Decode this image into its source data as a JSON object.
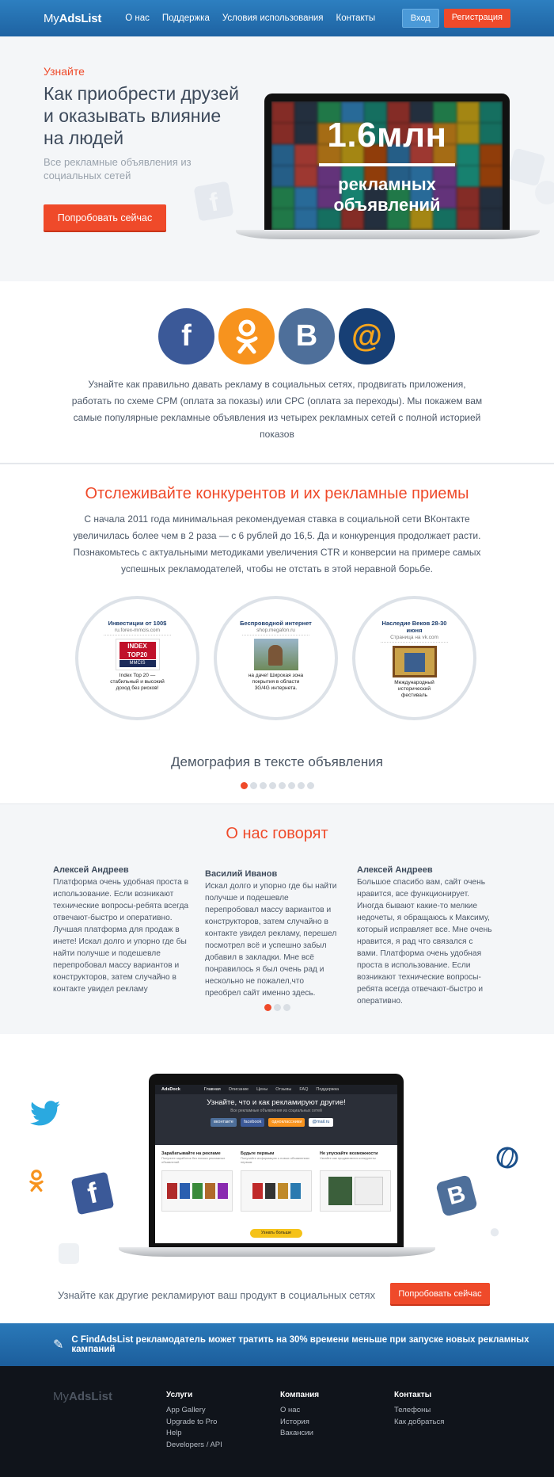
{
  "header": {
    "logo_light": "My",
    "logo_bold": "AdsList",
    "nav": [
      "О нас",
      "Поддержка",
      "Условия использования",
      "Контакты"
    ],
    "login": "Вход",
    "register": "Регистрация"
  },
  "hero": {
    "kicker": "Узнайте",
    "title": "Как приобрести друзей и оказывать влияние на людей",
    "subtitle": "Все рекламные объявления из социальных сетей",
    "cta": "Попробовать сейчас",
    "screen_number": "1.6млн",
    "screen_text_1": "рекламных",
    "screen_text_2": "объявлений"
  },
  "social": {
    "icons": [
      {
        "name": "facebook-icon",
        "glyph": "f",
        "color": "#3b5998"
      },
      {
        "name": "odnoklassniki-icon",
        "glyph": "ok",
        "color": "#f7931e"
      },
      {
        "name": "vkontakte-icon",
        "glyph": "B",
        "color": "#4e6f9a"
      },
      {
        "name": "mailru-icon",
        "glyph": "@",
        "color": "#1a4f8a"
      }
    ],
    "text": "Узнайте как правильно давать рекламу в социальных сетях, продвигать приложения, работать по схеме CPM (оплата за показы) или CPC (оплата за переходы). Мы покажем вам самые популярные рекламные объявления из четырех рекламных сетей с полной историей показов"
  },
  "competitors": {
    "title": "Отслеживайте конкурентов и их рекламные приемы",
    "text": "С начала 2011 года минимальная рекомендуемая ставка в социальной сети ВКонтакте увеличилась более чем в 2 раза — с 6 рублей до 16,5. Да и конкуренция продолжает расти. Познакомьтесь с актуальными методиками увеличения CTR и конверсии на примере самых успешных рекламодателей, чтобы не отстать в этой неравной борьбе.",
    "ads": [
      {
        "head": "Инвестиции от 100$",
        "url": "ru.forex-mmcis.com",
        "desc": "Index Top 20 — стабильный и высокий доход без рисков!",
        "img_label": "INDEX TOP20",
        "img_sub": "MMCIS"
      },
      {
        "head": "Беспроводной интернет",
        "url": "shop.megafon.ru",
        "desc": "на даче! Широкая зона покрытия в области 3G/4G интернета.",
        "img_label": "",
        "img_sub": ""
      },
      {
        "head": "Наследие Веков 28-30 июня",
        "url": "Страница на vk.com",
        "desc": "Международный исторический фестиваль",
        "img_label": "",
        "img_sub": ""
      }
    ],
    "caption": "Демография в тексте объявления",
    "dots_total": 8,
    "dots_active": 0
  },
  "testimonials": {
    "title": "О нас говорят",
    "items": [
      {
        "name": "Алексей Андреев",
        "text": "Платформа очень удобная проста в использование. Если возникают технические вопросы-ребята всегда отвечают-быстро и оперативно. Лучшая платформа для продаж в инете! Искал долго и упорно где бы найти получше и подешевле перепробовал массу вариантов и конструкторов, затем случайно в контакте увидел рекламу"
      },
      {
        "name": "Василий Иванов",
        "text": "Искал долго и упорно где бы найти получше и подешевле перепробовал массу вариантов и конструкторов, затем случайно в контакте увидел рекламу, перешел посмотрел всё и успешно забыл добавил в закладки. Мне всё понравилось я был очень рад и нескольно не пожалел,что преобрел сайт именно здесь."
      },
      {
        "name": "Алексей Андреев",
        "text": "Большое спасибо вам, сайт очень нравится, все функционирует. Иногда бывают какие-то мелкие недочеты, я обращаюсь к Максиму, который исправляет все. Мне очень нравится, я рад что связался с вами. Платформа очень удобная проста в использование. Если возникают технические вопросы-ребята всегда отвечают-быстро и оперативно."
      }
    ],
    "dots_total": 3,
    "dots_active": 0
  },
  "promo": {
    "screen_brand": "AdsDock",
    "screen_nav": [
      "Главная",
      "Описание",
      "Цены",
      "Отзывы",
      "FAQ",
      "Поддержка"
    ],
    "screen_title": "Узнайте, что и как рекламируют другие!",
    "screen_sub": "Все рекламные объявления из социальных сетей",
    "screen_logos": [
      "вконтакте",
      "facebook",
      "одноклассники",
      "@mail.ru"
    ],
    "screen_cols": [
      {
        "title": "Зарабатывайте на рекламе",
        "text": "Получите заработок без поиска рекламных объявлений"
      },
      {
        "title": "Будьте первым",
        "text": "Получайте информацию о новых объявлениях первым"
      },
      {
        "title": "Не упускайте возможности",
        "text": "Узнайте как продвигаются конкуренты"
      }
    ],
    "screen_btn": "Узнать больше",
    "text": "Узнайте как другие рекламируют ваш продукт в социальных сетях",
    "cta": "Попробовать сейчас"
  },
  "banner": {
    "text": "С FindAdsList рекламодатель может тратить на 30% времени меньше при запуске новых рекламных кампаний"
  },
  "footer": {
    "logo_light": "My",
    "logo_bold": "AdsList",
    "columns": [
      {
        "title": "Услуги",
        "links": [
          "App Gallery",
          "Upgrade to Pro",
          "Help",
          "Developers / API"
        ]
      },
      {
        "title": "Компания",
        "links": [
          "О нас",
          "История",
          "Вакансии"
        ]
      },
      {
        "title": "Контакты",
        "links": [
          "Телефоны",
          "Как добраться"
        ]
      }
    ]
  },
  "colors": {
    "accent": "#ef4a2a",
    "header_blue": "#1e63a2",
    "footer_bg": "#10141b"
  }
}
